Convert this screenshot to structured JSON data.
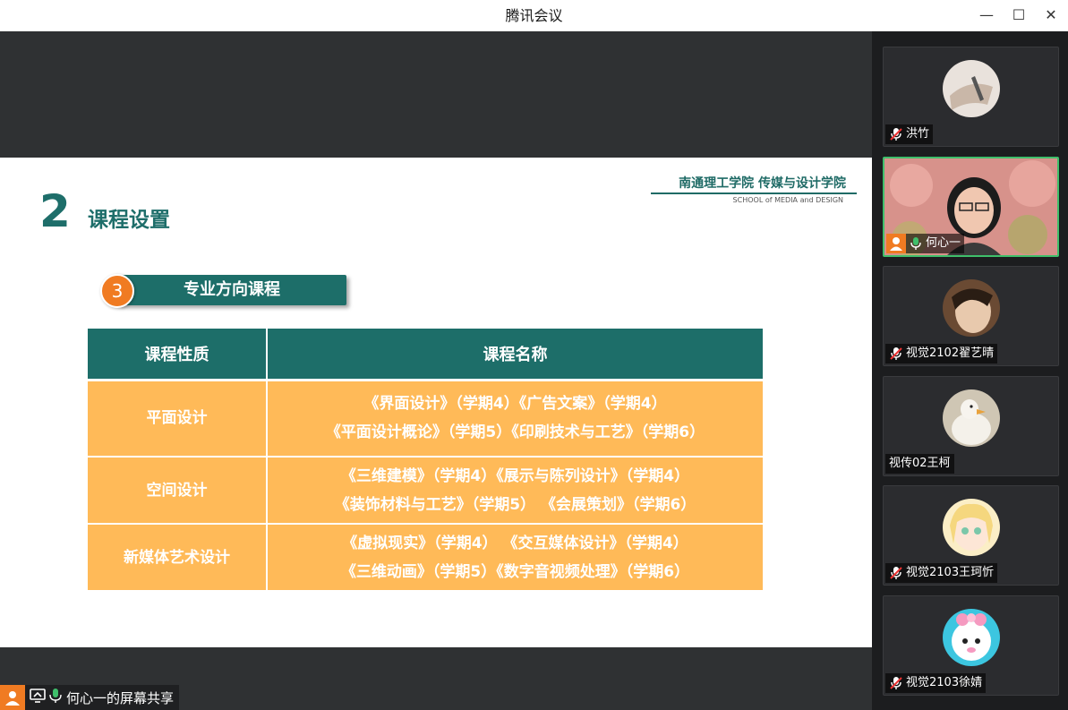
{
  "window": {
    "title": "腾讯会议",
    "minimize": "—",
    "maximize": "☐",
    "close": "✕"
  },
  "slide": {
    "school_cn": "南通理工学院 传媒与设计学院",
    "school_en": "SCHOOL of MEDIA and DESIGN",
    "section_number": "2",
    "section_title": "课程设置",
    "banner_number": "3",
    "banner_title": "专业方向课程",
    "table": {
      "headers": [
        "课程性质",
        "课程名称"
      ],
      "rows": [
        {
          "category": "平面设计",
          "line1": "《界面设计》（学期4）《广告文案》（学期4）",
          "line2": "《平面设计概论》（学期5）《印刷技术与工艺》（学期6）"
        },
        {
          "category": "空间设计",
          "line1": "《三维建模》（学期4）《展示与陈列设计》（学期4）",
          "line2": "《装饰材料与工艺》（学期5） 《会展策划》（学期6）"
        },
        {
          "category": "新媒体艺术设计",
          "line1": "《虚拟现实》（学期4） 《交互媒体设计》（学期4）",
          "line2": "《三维动画》（学期5）《数字音视频处理》（学期6）"
        }
      ]
    }
  },
  "participants": [
    {
      "name": "洪竹",
      "muted": true
    },
    {
      "name": "何心一",
      "muted": false
    },
    {
      "name": "视觉2102翟艺晴",
      "muted": true
    },
    {
      "name": "视传02王柯",
      "muted": false
    },
    {
      "name": "视觉2103王珂忻",
      "muted": true
    },
    {
      "name": "视觉2103徐婧",
      "muted": true
    }
  ],
  "share_bar": {
    "text": "何心一的屏幕共享"
  },
  "colors": {
    "teal": "#1d6e69",
    "orange_cell": "#ffba58",
    "badge_orange": "#f07b22",
    "active_speaker": "#3fbf6b"
  }
}
